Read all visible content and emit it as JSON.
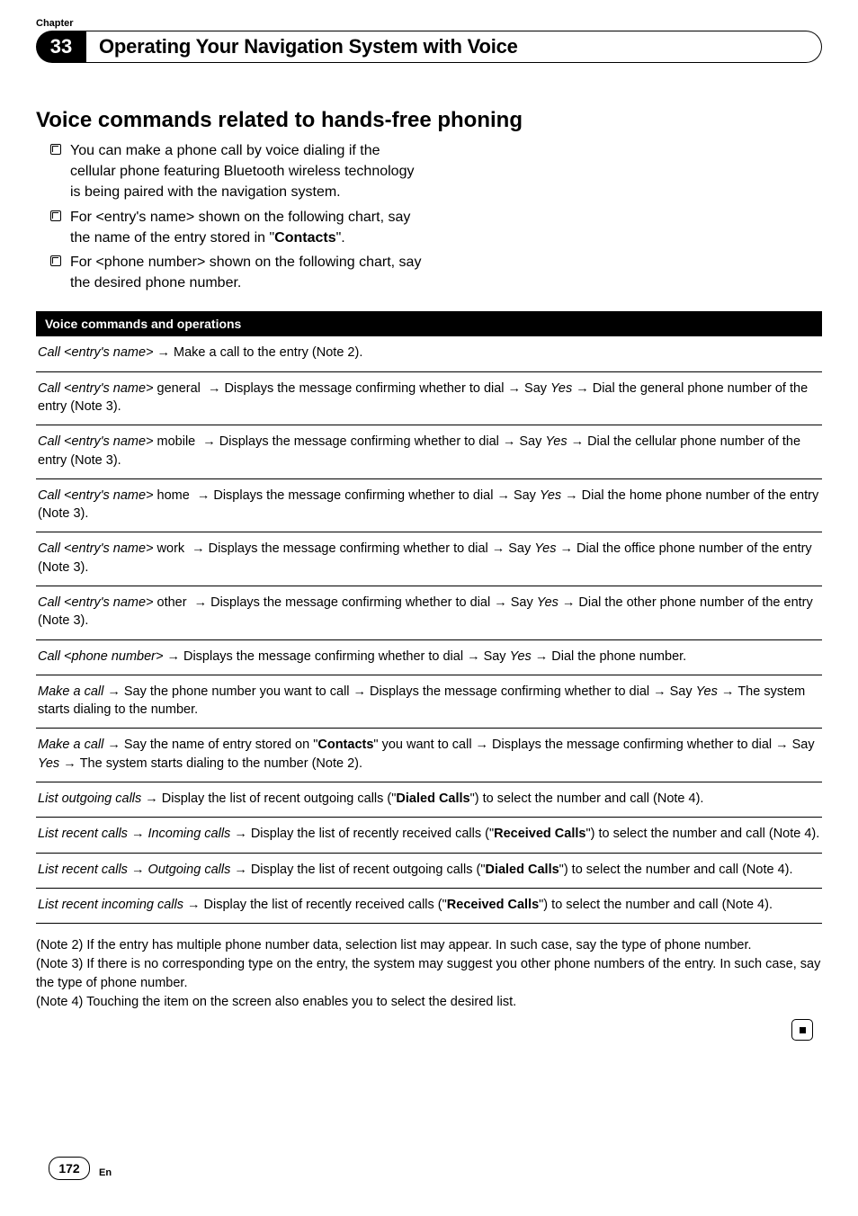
{
  "chapter_label": "Chapter",
  "chapter_number": "33",
  "chapter_title": "Operating Your Navigation System with Voice",
  "section_heading": "Voice commands related to hands-free phoning",
  "intro": [
    {
      "pre": "You can make a phone call by voice dialing if the cellular phone featuring Bluetooth wireless technology is being paired with the navigation system."
    },
    {
      "pre": "For <entry's name> shown on the following chart, say the name of the entry stored in \"",
      "bold": "Contacts",
      "post": "\"."
    },
    {
      "pre": "For <phone number> shown on the following chart, say the desired phone number."
    }
  ],
  "cmd_header": "Voice commands and operations",
  "rows": [
    {
      "parts": [
        {
          "t": "Call <entry's name>",
          "s": "italic"
        },
        {
          "t": "→",
          "s": "arrow"
        },
        {
          "t": "Make a call to the entry (Note 2)."
        }
      ]
    },
    {
      "parts": [
        {
          "t": "Call <entry's name>",
          "s": "italic"
        },
        {
          "t": " general "
        },
        {
          "t": "→",
          "s": "arrow"
        },
        {
          "t": "Displays the message confirming whether to dial"
        },
        {
          "t": "→",
          "s": "arrow"
        },
        {
          "t": "Say "
        },
        {
          "t": "Yes",
          "s": "italic"
        },
        {
          "t": "→",
          "s": "arrow"
        },
        {
          "t": "Dial the general phone number of the entry (Note 3)."
        }
      ]
    },
    {
      "parts": [
        {
          "t": "Call <entry's name>",
          "s": "italic"
        },
        {
          "t": " mobile "
        },
        {
          "t": "→",
          "s": "arrow"
        },
        {
          "t": "Displays the message confirming whether to dial"
        },
        {
          "t": "→",
          "s": "arrow"
        },
        {
          "t": "Say "
        },
        {
          "t": "Yes",
          "s": "italic"
        },
        {
          "t": "→",
          "s": "arrow"
        },
        {
          "t": "Dial the cellular phone number of the entry (Note 3)."
        }
      ]
    },
    {
      "parts": [
        {
          "t": "Call <entry's name>",
          "s": "italic"
        },
        {
          "t": " home "
        },
        {
          "t": "→",
          "s": "arrow"
        },
        {
          "t": "Displays the message confirming whether to dial"
        },
        {
          "t": "→",
          "s": "arrow"
        },
        {
          "t": "Say "
        },
        {
          "t": "Yes",
          "s": "italic"
        },
        {
          "t": "→",
          "s": "arrow"
        },
        {
          "t": "Dial the home phone number of the entry (Note 3)."
        }
      ]
    },
    {
      "parts": [
        {
          "t": "Call <entry's name>",
          "s": "italic"
        },
        {
          "t": " work "
        },
        {
          "t": "→",
          "s": "arrow"
        },
        {
          "t": "Displays the message confirming whether to dial"
        },
        {
          "t": "→",
          "s": "arrow"
        },
        {
          "t": "Say "
        },
        {
          "t": "Yes",
          "s": "italic"
        },
        {
          "t": "→",
          "s": "arrow"
        },
        {
          "t": "Dial the office phone number of the entry (Note 3)."
        }
      ]
    },
    {
      "parts": [
        {
          "t": "Call <entry's name>",
          "s": "italic"
        },
        {
          "t": " other "
        },
        {
          "t": "→",
          "s": "arrow"
        },
        {
          "t": "Displays the message confirming whether to dial"
        },
        {
          "t": "→",
          "s": "arrow"
        },
        {
          "t": "Say "
        },
        {
          "t": "Yes",
          "s": "italic"
        },
        {
          "t": "→",
          "s": "arrow"
        },
        {
          "t": "Dial the other phone number of the entry (Note 3)."
        }
      ]
    },
    {
      "parts": [
        {
          "t": "Call <phone number>",
          "s": "italic"
        },
        {
          "t": "→",
          "s": "arrow"
        },
        {
          "t": "Displays the message confirming whether to dial"
        },
        {
          "t": "→",
          "s": "arrow"
        },
        {
          "t": "Say "
        },
        {
          "t": "Yes",
          "s": "italic"
        },
        {
          "t": "→",
          "s": "arrow"
        },
        {
          "t": "Dial the phone number."
        }
      ]
    },
    {
      "parts": [
        {
          "t": "Make a call",
          "s": "italic"
        },
        {
          "t": "→",
          "s": "arrow"
        },
        {
          "t": "Say the phone number you want to call"
        },
        {
          "t": "→",
          "s": "arrow"
        },
        {
          "t": "Displays the message confirming whether to dial"
        },
        {
          "t": "→",
          "s": "arrow"
        },
        {
          "t": "Say "
        },
        {
          "t": "Yes",
          "s": "italic"
        },
        {
          "t": "→",
          "s": "arrow"
        },
        {
          "t": "The system starts dialing to the number."
        }
      ]
    },
    {
      "parts": [
        {
          "t": "Make a call",
          "s": "italic"
        },
        {
          "t": "→",
          "s": "arrow"
        },
        {
          "t": "Say the name of entry stored on \""
        },
        {
          "t": "Contacts",
          "s": "bold"
        },
        {
          "t": "\" you want to call"
        },
        {
          "t": "→",
          "s": "arrow"
        },
        {
          "t": "Displays the message confirming whether to dial"
        },
        {
          "t": "→",
          "s": "arrow"
        },
        {
          "t": "Say "
        },
        {
          "t": "Yes",
          "s": "italic"
        },
        {
          "t": "→",
          "s": "arrow"
        },
        {
          "t": "The system starts dialing to the number (Note 2)."
        }
      ]
    },
    {
      "parts": [
        {
          "t": "List outgoing calls",
          "s": "italic"
        },
        {
          "t": "→",
          "s": "arrow"
        },
        {
          "t": "Display the list of recent outgoing calls (\""
        },
        {
          "t": "Dialed Calls",
          "s": "bold"
        },
        {
          "t": "\") to select the number and call (Note 4)."
        }
      ]
    },
    {
      "parts": [
        {
          "t": "List recent calls",
          "s": "italic"
        },
        {
          "t": "→",
          "s": "arrow"
        },
        {
          "t": "Incoming calls",
          "s": "italic"
        },
        {
          "t": "→",
          "s": "arrow"
        },
        {
          "t": "Display the list of recently received calls (\""
        },
        {
          "t": "Received Calls",
          "s": "bold"
        },
        {
          "t": "\") to select the number and call (Note 4)."
        }
      ]
    },
    {
      "parts": [
        {
          "t": "List recent calls",
          "s": "italic"
        },
        {
          "t": "→",
          "s": "arrow"
        },
        {
          "t": "Outgoing calls",
          "s": "italic"
        },
        {
          "t": "→",
          "s": "arrow"
        },
        {
          "t": "Display the list of recent outgoing calls (\""
        },
        {
          "t": "Dialed Calls",
          "s": "bold"
        },
        {
          "t": "\") to select the number and call (Note 4)."
        }
      ]
    },
    {
      "parts": [
        {
          "t": "List recent incoming calls",
          "s": "italic"
        },
        {
          "t": "→",
          "s": "arrow"
        },
        {
          "t": "Display the list of recently received calls (\""
        },
        {
          "t": "Received Calls",
          "s": "bold"
        },
        {
          "t": "\") to select the number and call (Note 4)."
        }
      ]
    }
  ],
  "notes": [
    "(Note 2) If the entry has multiple phone number data, selection list may appear. In such case, say the type of phone number.",
    "(Note 3) If there is no corresponding type on the entry, the system may suggest you other phone numbers of the entry. In such case, say the type of phone number.",
    "(Note 4) Touching the item on the screen also enables you to select the desired list."
  ],
  "page_number": "172",
  "lang": "En"
}
